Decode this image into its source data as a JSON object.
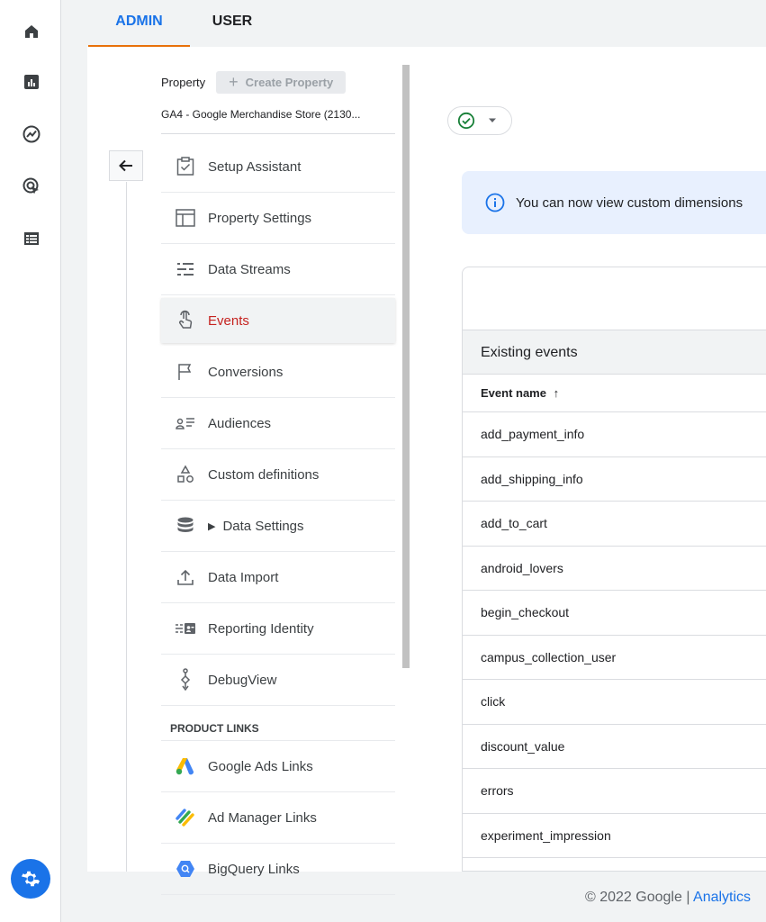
{
  "tabs": {
    "admin": "ADMIN",
    "user": "USER"
  },
  "property": {
    "label": "Property",
    "create_button": "Create Property",
    "name": "GA4 - Google Merchandise Store (2130..."
  },
  "menu": {
    "setup_assistant": "Setup Assistant",
    "property_settings": "Property Settings",
    "data_streams": "Data Streams",
    "events": "Events",
    "conversions": "Conversions",
    "audiences": "Audiences",
    "custom_definitions": "Custom definitions",
    "data_settings": "Data Settings",
    "data_import": "Data Import",
    "reporting_identity": "Reporting Identity",
    "debugview": "DebugView",
    "product_links_header": "PRODUCT LINKS",
    "google_ads_links": "Google Ads Links",
    "ad_manager_links": "Ad Manager Links",
    "bigquery_links": "BigQuery Links"
  },
  "banner": {
    "text": "You can now view custom dimensions"
  },
  "events_table": {
    "title": "Existing events",
    "column_header": "Event name",
    "rows": [
      "add_payment_info",
      "add_shipping_info",
      "add_to_cart",
      "android_lovers",
      "begin_checkout",
      "campus_collection_user",
      "click",
      "discount_value",
      "errors",
      "experiment_impression"
    ]
  },
  "footer": {
    "copyright": "© 2022 Google | ",
    "link": "Analytics"
  },
  "colors": {
    "accent": "#1a73e8",
    "active": "#c5221f",
    "tab_underline": "#e8710a",
    "success": "#188038"
  }
}
